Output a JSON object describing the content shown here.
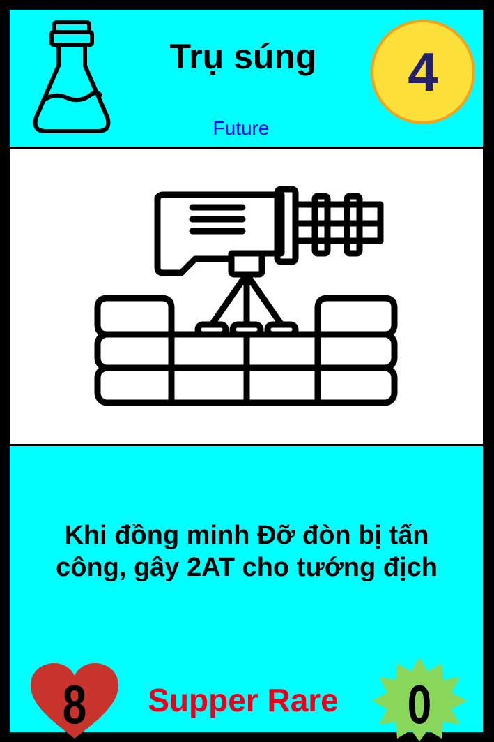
{
  "card": {
    "name": "Trụ súng",
    "faction": "Future",
    "cost": "4",
    "description_line1": "Khi đồng minh Đỡ đòn bị tấn",
    "description_line2": "công, gây 2AT cho tướng địch",
    "rarity": "Supper Rare",
    "health": "8",
    "attack": "0"
  },
  "icons": {
    "type_icon": "flask-icon",
    "art": "turret-on-wall-icon",
    "health_icon": "heart-icon",
    "attack_icon": "burst-icon"
  },
  "colors": {
    "background": "#00ffff",
    "border": "#000000",
    "cost_fill": "#fde13a",
    "cost_ring": "#f3a21c",
    "cost_text": "#24206e",
    "faction_text": "#0000ff",
    "rarity_text": "#e8001c",
    "heart": "#c8342c",
    "burst": "#88d75a"
  }
}
